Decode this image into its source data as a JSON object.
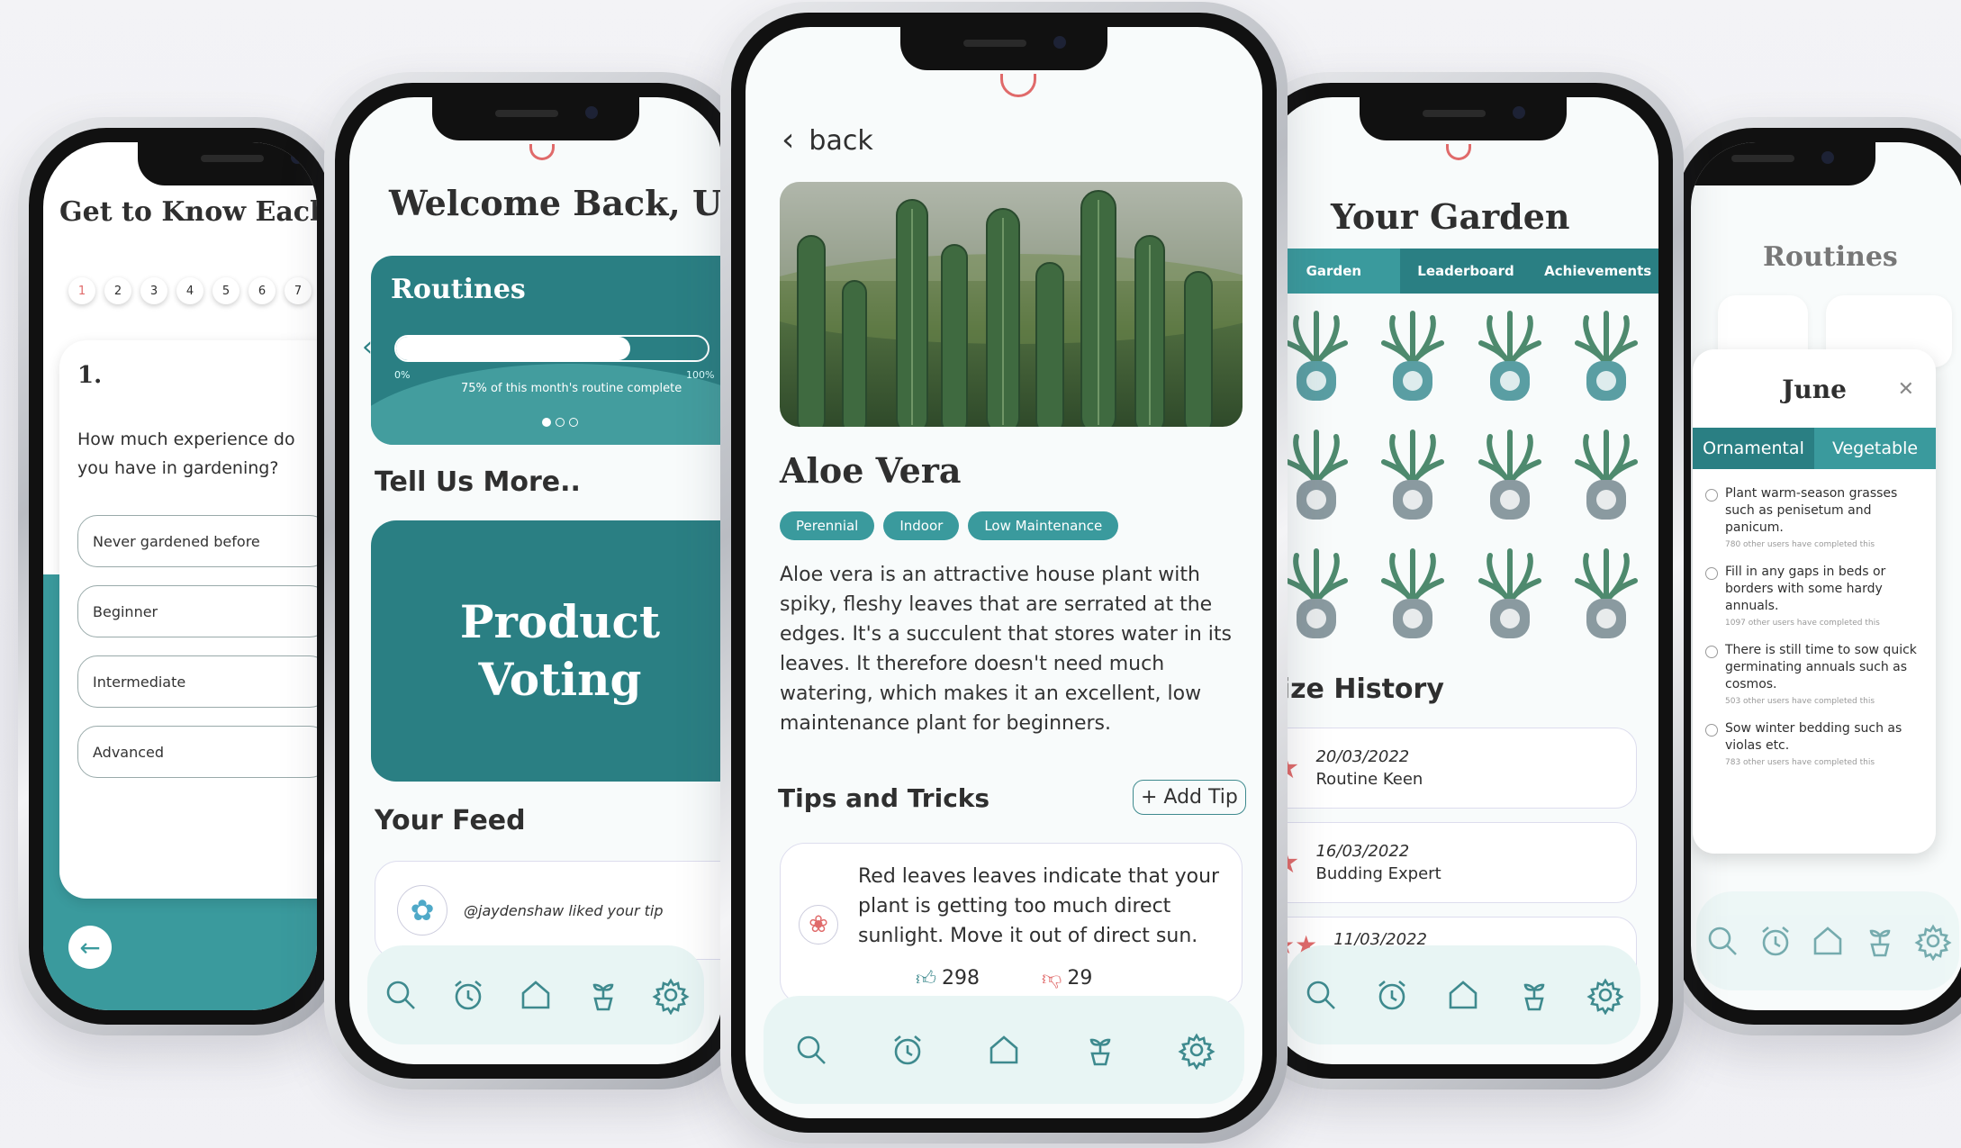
{
  "phone1": {
    "title": "Get to Know Each Othe",
    "steps": [
      "1",
      "2",
      "3",
      "4",
      "5",
      "6",
      "7"
    ],
    "question_number": "1.",
    "question": "How much experience do you have in gardening?",
    "options": [
      "Never gardened before",
      "Beginner",
      "Intermediate",
      "Advanced"
    ]
  },
  "phone2": {
    "title": "Welcome Back, User",
    "routines_label": "Routines",
    "progress_min": "0%",
    "progress_max": "100%",
    "progress_value": 0.75,
    "progress_caption": "75% of this month's routine complete",
    "tell_more": "Tell Us More..",
    "product_voting": "Product Voting",
    "your_feed": "Your Feed",
    "feed_item": "@jaydenshaw liked your tip"
  },
  "phone3": {
    "back_label": "back",
    "plant_name": "Aloe Vera",
    "tags": [
      "Perennial",
      "Indoor",
      "Low Maintenance"
    ],
    "description": "Aloe vera is an attractive house plant with spiky, fleshy leaves that are serrated at the edges. It's a succulent that stores water in its leaves. It therefore doesn't need much watering, which makes it an excellent, low maintenance plant for beginners.",
    "tips_title": "Tips and Tricks",
    "add_tip": "+ Add Tip",
    "tip_text": "Red leaves leaves indicate that your plant is getting too much direct sunlight. Move it out of direct sun.",
    "likes": "298",
    "dislikes": "29"
  },
  "phone4": {
    "title": "Your Garden",
    "tabs": [
      "Garden",
      "Leaderboard",
      "Achievements"
    ],
    "prize_title": "rize History",
    "prizes": [
      {
        "date": "20/03/2022",
        "name": "Routine Keen"
      },
      {
        "date": "16/03/2022",
        "name": "Budding Expert"
      },
      {
        "date": "11/03/2022",
        "name": ""
      }
    ]
  },
  "phone5": {
    "title": "Routines",
    "month": "June",
    "tabs": [
      "Ornamental",
      "Vegetable"
    ],
    "tasks": [
      {
        "text": "Plant warm-season grasses such as penisetum and panicum.",
        "sub": "780 other users have completed this"
      },
      {
        "text": "Fill in any gaps in beds or borders with some hardy annuals.",
        "sub": "1097 other users have completed this"
      },
      {
        "text": "There is still time to sow quick germinating annuals such as cosmos.",
        "sub": "503 other users have completed this"
      },
      {
        "text": "Sow winter bedding such as violas etc.",
        "sub": "783 other users have completed this"
      }
    ]
  },
  "colors": {
    "teal": "#2a7f83",
    "teal_light": "#3a9a9d",
    "accent_red": "#e06a6a",
    "nav_bg": "#e8f5f4"
  },
  "nav_icons": [
    "search-icon",
    "alarm-icon",
    "home-icon",
    "plant-icon",
    "gear-icon"
  ]
}
